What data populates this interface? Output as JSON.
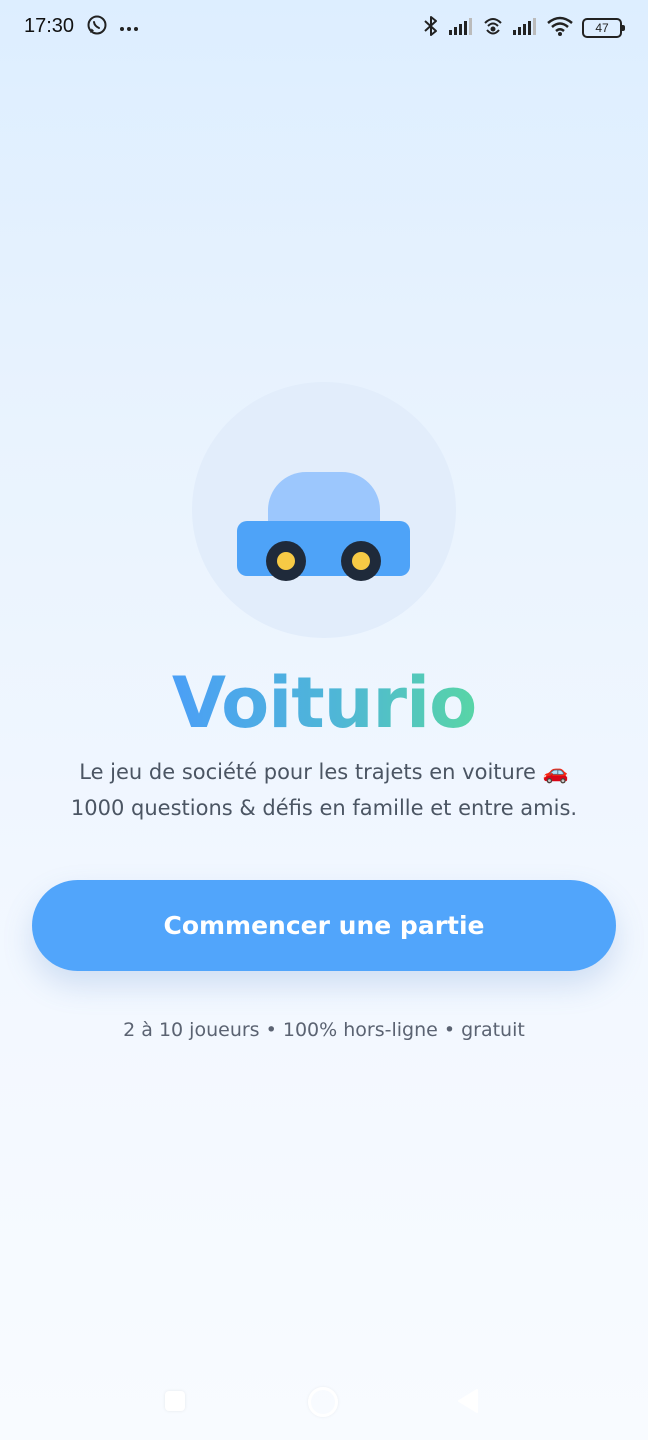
{
  "status_bar": {
    "time": "17:30",
    "battery": "47",
    "icons": [
      "whatsapp-icon",
      "more-dots-icon",
      "bluetooth-icon",
      "signal-icon",
      "hotspot-icon",
      "signal-icon",
      "wifi-icon",
      "battery-icon"
    ]
  },
  "hero": {
    "logo_icon": "car-icon",
    "title": "Voiturio",
    "tagline_line1": "Le jeu de société pour les trajets en voiture 🚗",
    "tagline_line2": "1000 questions & défis en famille et entre amis."
  },
  "actions": {
    "start_label": "Commencer une partie"
  },
  "footer": {
    "note": "2 à 10 joueurs • 100% hors-ligne • gratuit"
  },
  "colors": {
    "accent": "#51a5fb",
    "title_gradient_start": "#4b9ff6",
    "title_gradient_end": "#58d5a6",
    "car_body": "#4ea3f8",
    "car_roof": "#9cc7fd",
    "wheel_hub": "#f7ca45"
  },
  "nav_bar": {
    "icons": [
      "recent-apps-icon",
      "home-icon",
      "back-icon"
    ]
  }
}
